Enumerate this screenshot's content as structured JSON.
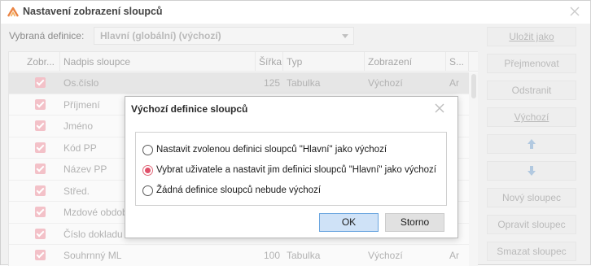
{
  "window": {
    "title": "Nastavení zobrazení sloupců"
  },
  "definition": {
    "label": "Vybraná definice:",
    "value": "Hlavní (globální) (výchozí)"
  },
  "grid": {
    "columns": [
      "Zobr...",
      "Nadpis sloupce",
      "Šířka",
      "Typ",
      "Zobrazení",
      "S..."
    ],
    "rows": [
      {
        "title": "Os.číslo",
        "width": "125",
        "type": "Tabulka",
        "display": "Výchozí",
        "s": "Ar"
      },
      {
        "title": "Příjmení",
        "width": "",
        "type": "",
        "display": "",
        "s": ""
      },
      {
        "title": "Jméno",
        "width": "",
        "type": "",
        "display": "",
        "s": ""
      },
      {
        "title": "Kód PP",
        "width": "",
        "type": "",
        "display": "",
        "s": ""
      },
      {
        "title": "Název PP",
        "width": "",
        "type": "",
        "display": "",
        "s": ""
      },
      {
        "title": "Střed.",
        "width": "",
        "type": "",
        "display": "",
        "s": ""
      },
      {
        "title": "Mzdové obdob",
        "width": "",
        "type": "",
        "display": "",
        "s": ""
      },
      {
        "title": "Číslo dokladu",
        "width": "",
        "type": "",
        "display": "",
        "s": ""
      },
      {
        "title": "Souhrnný ML",
        "width": "100",
        "type": "Tabulka",
        "display": "Výchozí",
        "s": "Ar"
      }
    ]
  },
  "side_buttons": {
    "save": "Uložit jako",
    "rename": "Přejmenovat",
    "remove": "Odstranit",
    "default": "Výchozí",
    "new_column": "Nový sloupec",
    "edit_column": "Opravit sloupec",
    "delete_column": "Smazat sloupec"
  },
  "dialog": {
    "title": "Výchozí definice sloupců",
    "options": [
      "Nastavit zvolenou definici sloupců \"Hlavní\" jako výchozí",
      "Vybrat uživatele a nastavit jim definici sloupců \"Hlavní\" jako výchozí",
      "Žádná definice sloupců nebude výchozí"
    ],
    "selected_option": 1,
    "ok_label": "OK",
    "cancel_label": "Storno"
  },
  "colors": {
    "accent": "#e0506a",
    "ok_fill": "#cfe2f7",
    "ok_border": "#6aa5df"
  }
}
